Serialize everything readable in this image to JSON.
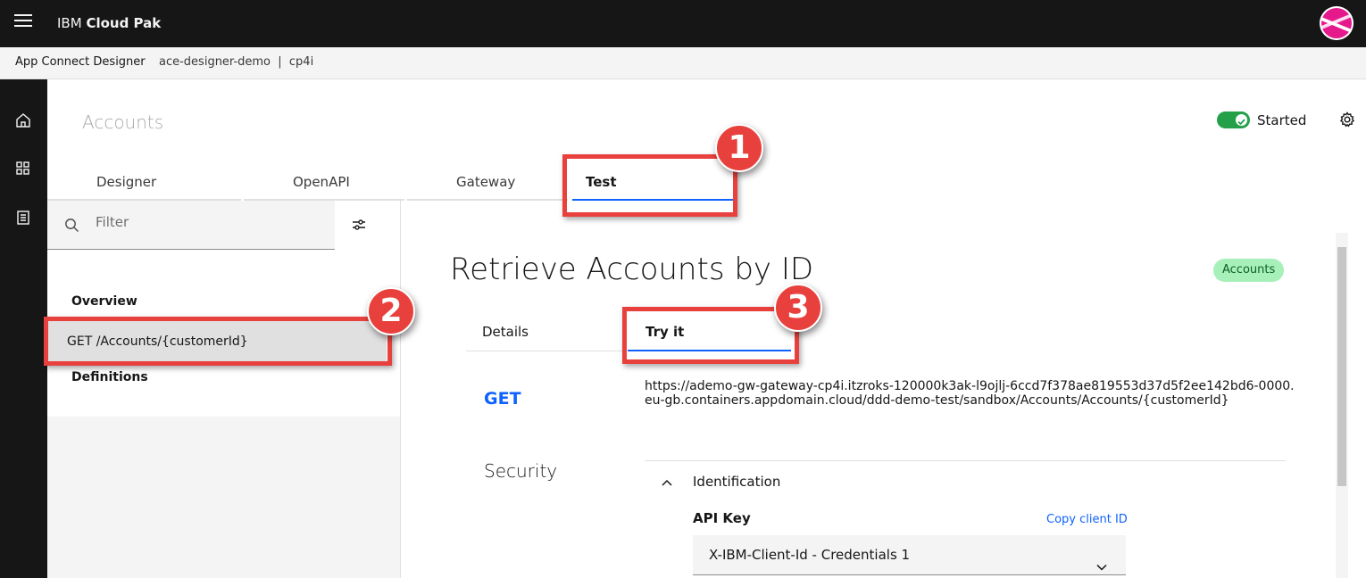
{
  "header": {
    "brand_prefix": "IBM",
    "brand_name": "Cloud Pak"
  },
  "breadcrumb": {
    "app": "App Connect Designer",
    "instance": "ace-designer-demo  |  cp4i"
  },
  "page": {
    "title": "Accounts",
    "status": "Started",
    "status_color": "#24a148"
  },
  "tabs": [
    {
      "label": "Designer"
    },
    {
      "label": "OpenAPI"
    },
    {
      "label": "Gateway"
    },
    {
      "label": "Test",
      "active": true
    }
  ],
  "left_panel": {
    "filter_placeholder": "Filter",
    "overview": "Overview",
    "operation": "GET /Accounts/{customerId}",
    "definitions": "Definitions"
  },
  "operation": {
    "title": "Retrieve Accounts by ID",
    "tag": "Accounts",
    "subtabs": [
      {
        "label": "Details"
      },
      {
        "label": "Try it",
        "active": true
      }
    ],
    "method": "GET",
    "url": "https://ademo-gw-gateway-cp4i.itzroks-120000k3ak-l9ojlj-6ccd7f378ae819553d37d5f2ee142bd6-0000.eu-gb.containers.appdomain.cloud/ddd-demo-test/sandbox/Accounts/Accounts/{customerId}",
    "security_heading": "Security",
    "identification": "Identification",
    "api_key_label": "API Key",
    "copy_link": "Copy client ID",
    "api_key_value": "X-IBM-Client-Id - Credentials 1"
  },
  "annotations": {
    "badge_1": "1",
    "badge_2": "2",
    "badge_3": "3",
    "color": "#e8413d"
  },
  "icons": [
    "menu-icon",
    "home-icon",
    "catalog-icon",
    "notebook-icon",
    "settings-icon",
    "search-icon",
    "sliders-icon",
    "chevron-up-icon",
    "chevron-down-icon",
    "checkmark-icon"
  ]
}
